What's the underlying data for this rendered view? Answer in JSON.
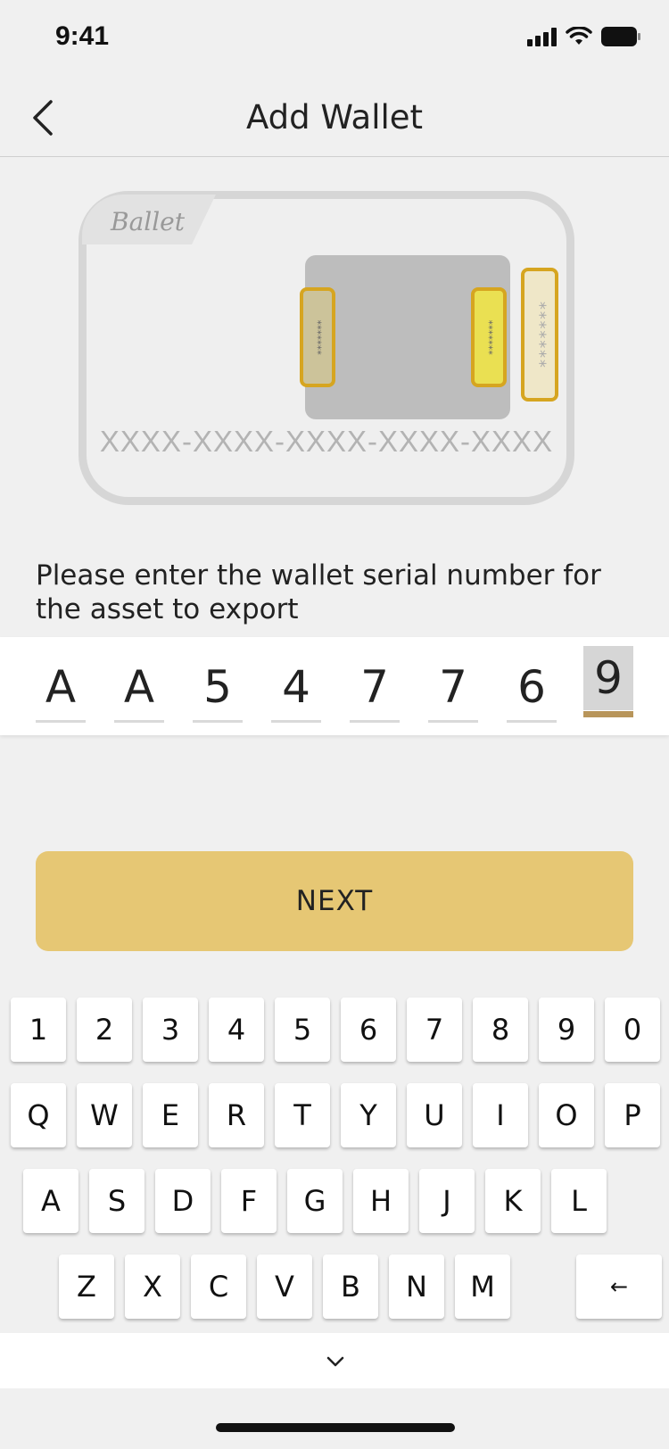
{
  "status_bar": {
    "time": "9:41",
    "icons": [
      "signal-icon",
      "wifi-icon",
      "battery-icon"
    ]
  },
  "nav": {
    "title": "Add Wallet",
    "back_icon": "chevron-left-icon"
  },
  "card": {
    "brand": "Ballet",
    "serial_mask": "XXXX-XXXX-XXXX-XXXX-XXXX",
    "strip_small": "*******",
    "strip_large": "*******"
  },
  "instruction": "Please enter the wallet serial number for the asset to export",
  "serial": {
    "chars": [
      "A",
      "A",
      "5",
      "4",
      "7",
      "7",
      "6",
      "9"
    ],
    "active_index": 7,
    "accent_color": "#b8955a"
  },
  "next_button": {
    "label": "NEXT",
    "color": "#e6c774"
  },
  "keyboard": {
    "row1": [
      "1",
      "2",
      "3",
      "4",
      "5",
      "6",
      "7",
      "8",
      "9",
      "0"
    ],
    "row2": [
      "Q",
      "W",
      "E",
      "R",
      "T",
      "Y",
      "U",
      "I",
      "O",
      "P"
    ],
    "row3": [
      "A",
      "S",
      "D",
      "F",
      "G",
      "H",
      "J",
      "K",
      "L"
    ],
    "row4": [
      "Z",
      "X",
      "C",
      "V",
      "B",
      "N",
      "M"
    ],
    "backspace": "←",
    "collapse_icon": "chevron-down-icon"
  }
}
